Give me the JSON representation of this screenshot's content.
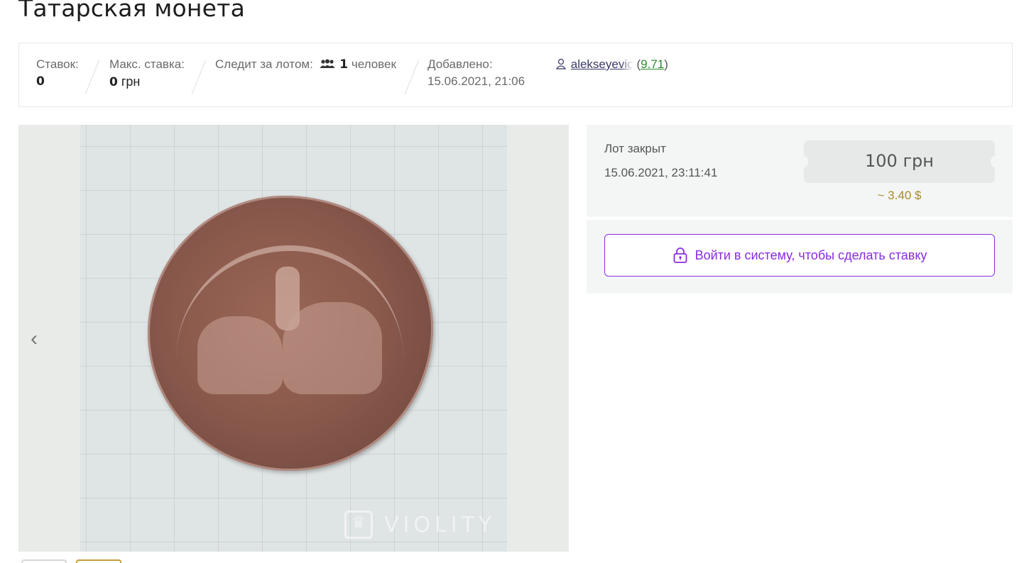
{
  "page": {
    "title": "Татарская монета"
  },
  "stats": {
    "bids_label": "Ставок:",
    "bids_value": "0",
    "max_bid_label": "Макс. ставка:",
    "max_bid_value": "0",
    "max_bid_currency": " грн",
    "watchers_label": "Следит за лотом:",
    "watchers_icon": "people-icon",
    "watchers_count": "1",
    "watchers_unit": "человек",
    "added_label": "Добавлено:",
    "added_value": "15.06.2021, 21:06"
  },
  "seller": {
    "icon": "user-icon",
    "username": "alekseyevic",
    "rating_open": "(",
    "rating": "9.71",
    "rating_close": ")"
  },
  "gallery": {
    "prev_icon": "chevron-left-icon",
    "prev_glyph": "‹",
    "watermark": "VIOLITY"
  },
  "lot": {
    "status": "Лот закрыт",
    "closed_at": "15.06.2021, 23:11:41",
    "price": "100 грн",
    "price_usd": "~ 3.40 $",
    "login_icon": "lock-icon",
    "login_label": "Войти в систему, чтобы сделать ставку"
  },
  "colors": {
    "accent": "#8a2be2",
    "price_usd": "#a88a2a",
    "rating": "#2c8a2c"
  }
}
